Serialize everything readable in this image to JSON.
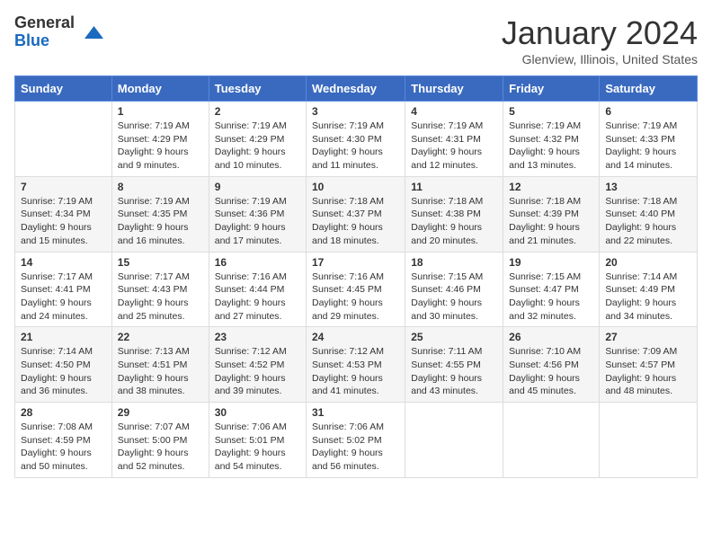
{
  "header": {
    "logo_general": "General",
    "logo_blue": "Blue",
    "month_title": "January 2024",
    "location": "Glenview, Illinois, United States"
  },
  "days_header": [
    "Sunday",
    "Monday",
    "Tuesday",
    "Wednesday",
    "Thursday",
    "Friday",
    "Saturday"
  ],
  "weeks": [
    [
      {
        "day": "",
        "detail": ""
      },
      {
        "day": "1",
        "detail": "Sunrise: 7:19 AM\nSunset: 4:29 PM\nDaylight: 9 hours\nand 9 minutes."
      },
      {
        "day": "2",
        "detail": "Sunrise: 7:19 AM\nSunset: 4:29 PM\nDaylight: 9 hours\nand 10 minutes."
      },
      {
        "day": "3",
        "detail": "Sunrise: 7:19 AM\nSunset: 4:30 PM\nDaylight: 9 hours\nand 11 minutes."
      },
      {
        "day": "4",
        "detail": "Sunrise: 7:19 AM\nSunset: 4:31 PM\nDaylight: 9 hours\nand 12 minutes."
      },
      {
        "day": "5",
        "detail": "Sunrise: 7:19 AM\nSunset: 4:32 PM\nDaylight: 9 hours\nand 13 minutes."
      },
      {
        "day": "6",
        "detail": "Sunrise: 7:19 AM\nSunset: 4:33 PM\nDaylight: 9 hours\nand 14 minutes."
      }
    ],
    [
      {
        "day": "7",
        "detail": "Sunrise: 7:19 AM\nSunset: 4:34 PM\nDaylight: 9 hours\nand 15 minutes."
      },
      {
        "day": "8",
        "detail": "Sunrise: 7:19 AM\nSunset: 4:35 PM\nDaylight: 9 hours\nand 16 minutes."
      },
      {
        "day": "9",
        "detail": "Sunrise: 7:19 AM\nSunset: 4:36 PM\nDaylight: 9 hours\nand 17 minutes."
      },
      {
        "day": "10",
        "detail": "Sunrise: 7:18 AM\nSunset: 4:37 PM\nDaylight: 9 hours\nand 18 minutes."
      },
      {
        "day": "11",
        "detail": "Sunrise: 7:18 AM\nSunset: 4:38 PM\nDaylight: 9 hours\nand 20 minutes."
      },
      {
        "day": "12",
        "detail": "Sunrise: 7:18 AM\nSunset: 4:39 PM\nDaylight: 9 hours\nand 21 minutes."
      },
      {
        "day": "13",
        "detail": "Sunrise: 7:18 AM\nSunset: 4:40 PM\nDaylight: 9 hours\nand 22 minutes."
      }
    ],
    [
      {
        "day": "14",
        "detail": "Sunrise: 7:17 AM\nSunset: 4:41 PM\nDaylight: 9 hours\nand 24 minutes."
      },
      {
        "day": "15",
        "detail": "Sunrise: 7:17 AM\nSunset: 4:43 PM\nDaylight: 9 hours\nand 25 minutes."
      },
      {
        "day": "16",
        "detail": "Sunrise: 7:16 AM\nSunset: 4:44 PM\nDaylight: 9 hours\nand 27 minutes."
      },
      {
        "day": "17",
        "detail": "Sunrise: 7:16 AM\nSunset: 4:45 PM\nDaylight: 9 hours\nand 29 minutes."
      },
      {
        "day": "18",
        "detail": "Sunrise: 7:15 AM\nSunset: 4:46 PM\nDaylight: 9 hours\nand 30 minutes."
      },
      {
        "day": "19",
        "detail": "Sunrise: 7:15 AM\nSunset: 4:47 PM\nDaylight: 9 hours\nand 32 minutes."
      },
      {
        "day": "20",
        "detail": "Sunrise: 7:14 AM\nSunset: 4:49 PM\nDaylight: 9 hours\nand 34 minutes."
      }
    ],
    [
      {
        "day": "21",
        "detail": "Sunrise: 7:14 AM\nSunset: 4:50 PM\nDaylight: 9 hours\nand 36 minutes."
      },
      {
        "day": "22",
        "detail": "Sunrise: 7:13 AM\nSunset: 4:51 PM\nDaylight: 9 hours\nand 38 minutes."
      },
      {
        "day": "23",
        "detail": "Sunrise: 7:12 AM\nSunset: 4:52 PM\nDaylight: 9 hours\nand 39 minutes."
      },
      {
        "day": "24",
        "detail": "Sunrise: 7:12 AM\nSunset: 4:53 PM\nDaylight: 9 hours\nand 41 minutes."
      },
      {
        "day": "25",
        "detail": "Sunrise: 7:11 AM\nSunset: 4:55 PM\nDaylight: 9 hours\nand 43 minutes."
      },
      {
        "day": "26",
        "detail": "Sunrise: 7:10 AM\nSunset: 4:56 PM\nDaylight: 9 hours\nand 45 minutes."
      },
      {
        "day": "27",
        "detail": "Sunrise: 7:09 AM\nSunset: 4:57 PM\nDaylight: 9 hours\nand 48 minutes."
      }
    ],
    [
      {
        "day": "28",
        "detail": "Sunrise: 7:08 AM\nSunset: 4:59 PM\nDaylight: 9 hours\nand 50 minutes."
      },
      {
        "day": "29",
        "detail": "Sunrise: 7:07 AM\nSunset: 5:00 PM\nDaylight: 9 hours\nand 52 minutes."
      },
      {
        "day": "30",
        "detail": "Sunrise: 7:06 AM\nSunset: 5:01 PM\nDaylight: 9 hours\nand 54 minutes."
      },
      {
        "day": "31",
        "detail": "Sunrise: 7:06 AM\nSunset: 5:02 PM\nDaylight: 9 hours\nand 56 minutes."
      },
      {
        "day": "",
        "detail": ""
      },
      {
        "day": "",
        "detail": ""
      },
      {
        "day": "",
        "detail": ""
      }
    ]
  ]
}
